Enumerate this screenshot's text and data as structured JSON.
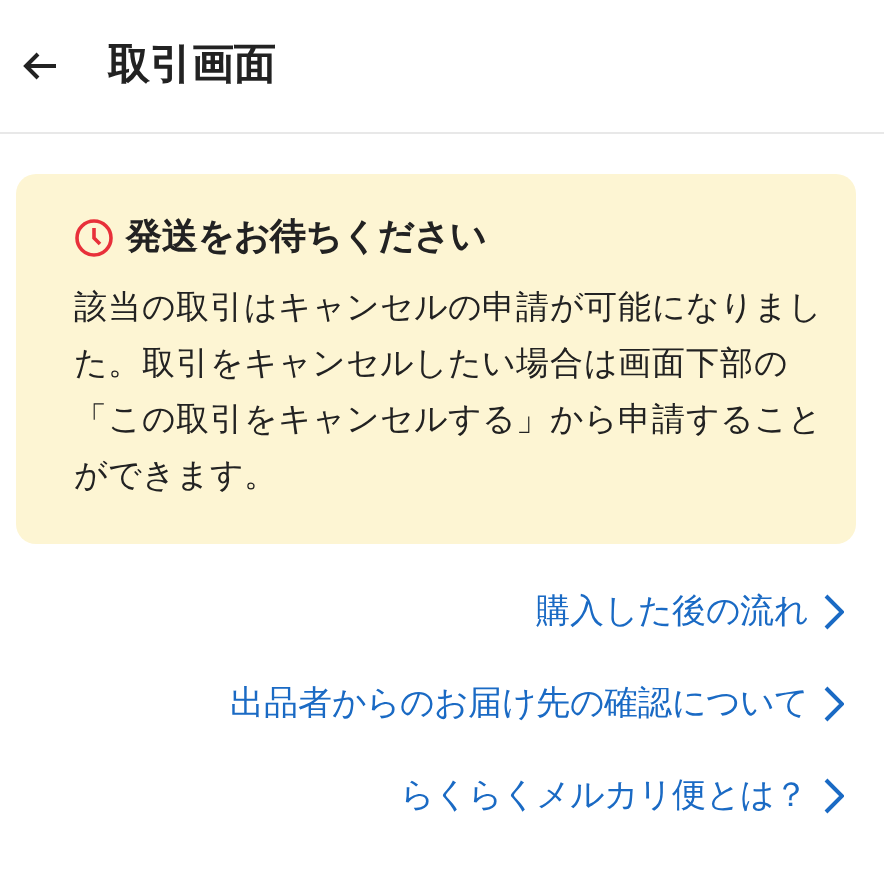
{
  "header": {
    "title": "取引画面"
  },
  "notice": {
    "title": "発送をお待ちください",
    "body": "該当の取引はキャンセルの申請が可能になりました。取引をキャンセルしたい場合は画面下部の「この取引をキャンセルする」から申請することができます。"
  },
  "links": [
    {
      "label": "購入した後の流れ"
    },
    {
      "label": "出品者からのお届け先の確認について"
    },
    {
      "label": "らくらくメルカリ便とは？"
    }
  ]
}
